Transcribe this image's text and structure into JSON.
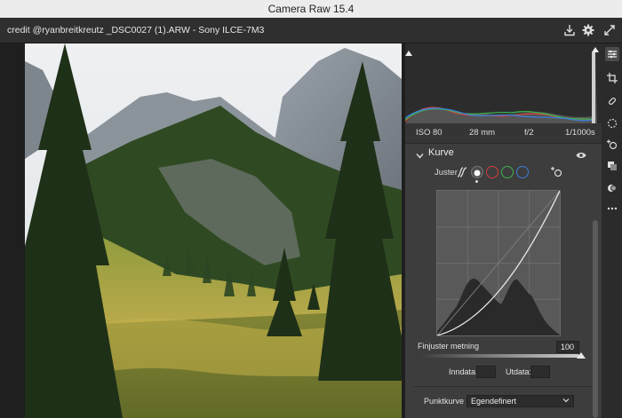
{
  "window": {
    "title": "Camera Raw 15.4"
  },
  "header": {
    "file_info": "credit @ryanbreitkreutz _DSC0027 (1).ARW  -  Sony ILCE-7M3"
  },
  "exif": {
    "iso": "ISO 80",
    "focal": "28 mm",
    "aperture": "f/2",
    "shutter": "1/1000s"
  },
  "section": {
    "title": "Kurve"
  },
  "curve": {
    "adjust_label": "Juster",
    "channels": [
      "parametric",
      "white",
      "red",
      "green",
      "blue"
    ],
    "fine_tune_label": "Finjuster metning",
    "fine_tune_value": "100",
    "input_label": "Inndata:",
    "output_label": "Utdata:",
    "input_value": "",
    "output_value": "",
    "point_curve_label": "Punktkurve",
    "point_curve_value": "Egendefinert"
  },
  "colors": {
    "accent_red": "#d43d3d",
    "accent_green": "#3fb34f",
    "accent_blue": "#3a7fd8"
  },
  "icons": [
    "export-icon",
    "settings-gear-icon",
    "fullscreen-icon",
    "edit-sliders-icon",
    "crop-icon",
    "healing-icon",
    "masking-icon",
    "redeye-icon",
    "presets-icon",
    "snapshots-icon",
    "more-icon"
  ]
}
